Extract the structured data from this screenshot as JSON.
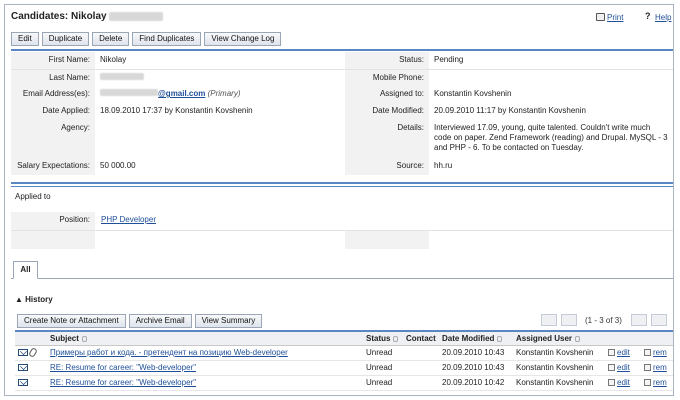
{
  "header": {
    "title": "Candidates: Nikolay",
    "print_label": "Print",
    "help_label": "Help"
  },
  "toolbar": {
    "edit_label": "Edit",
    "duplicate_label": "Duplicate",
    "delete_label": "Delete",
    "find_duplicates_label": "Find Duplicates",
    "view_change_log_label": "View Change Log"
  },
  "details": {
    "first_name_label": "First Name:",
    "first_name_value": "Nikolay",
    "status_label": "Status:",
    "status_value": "Pending",
    "last_name_label": "Last Name:",
    "mobile_phone_label": "Mobile Phone:",
    "email_label": "Email Address(es):",
    "email_value": "@gmail.com",
    "email_primary": "(Primary)",
    "assigned_to_label": "Assigned to:",
    "assigned_to_value": "Konstantin Kovshenin",
    "date_applied_label": "Date Applied:",
    "date_applied_value": "18.09.2010 17:37 by Konstantin Kovshenin",
    "date_modified_label": "Date Modified:",
    "date_modified_value": "20.09.2010 11:17 by Konstantin Kovshenin",
    "agency_label": "Agency:",
    "details_label": "Details:",
    "details_value": "Interviewed 17.09, young, quite talented. Couldn't write much code on paper. Zend Framework (reading) and Drupal. MySQL - 3 and PHP - 6. To be contacted on Tuesday.",
    "salary_label": "Salary Expectations:",
    "salary_value": "50 000.00",
    "source_label": "Source:",
    "source_value": "hh.ru"
  },
  "applied_to": {
    "heading": "Applied to",
    "position_label": "Position:",
    "position_value": "PHP Developer"
  },
  "tabs": {
    "all_label": "All"
  },
  "history": {
    "heading": "History",
    "create_note_label": "Create Note or Attachment",
    "archive_email_label": "Archive Email",
    "view_summary_label": "View Summary",
    "pager_text": "(1 - 3 of 3)",
    "columns": [
      "Subject",
      "Status",
      "Contact",
      "Date Modified",
      "Assigned User"
    ],
    "rows": [
      {
        "subject": "Примеры работ и кода. - претендент на позицию Web-developer",
        "status": "Unread",
        "contact": "",
        "date": "20.09.2010 10:43",
        "user": "Konstantin Kovshenin",
        "edit": "edit",
        "rem": "rem"
      },
      {
        "subject": "RE: Resume for career: \"Web-developer\"",
        "status": "Unread",
        "contact": "",
        "date": "20.09.2010 10:43",
        "user": "Konstantin Kovshenin",
        "edit": "edit",
        "rem": "rem"
      },
      {
        "subject": "RE: Resume for career: \"Web-developer\"",
        "status": "Unread",
        "contact": "",
        "date": "20.09.2010 10:42",
        "user": "Konstantin Kovshenin",
        "edit": "edit",
        "rem": "rem"
      }
    ]
  }
}
